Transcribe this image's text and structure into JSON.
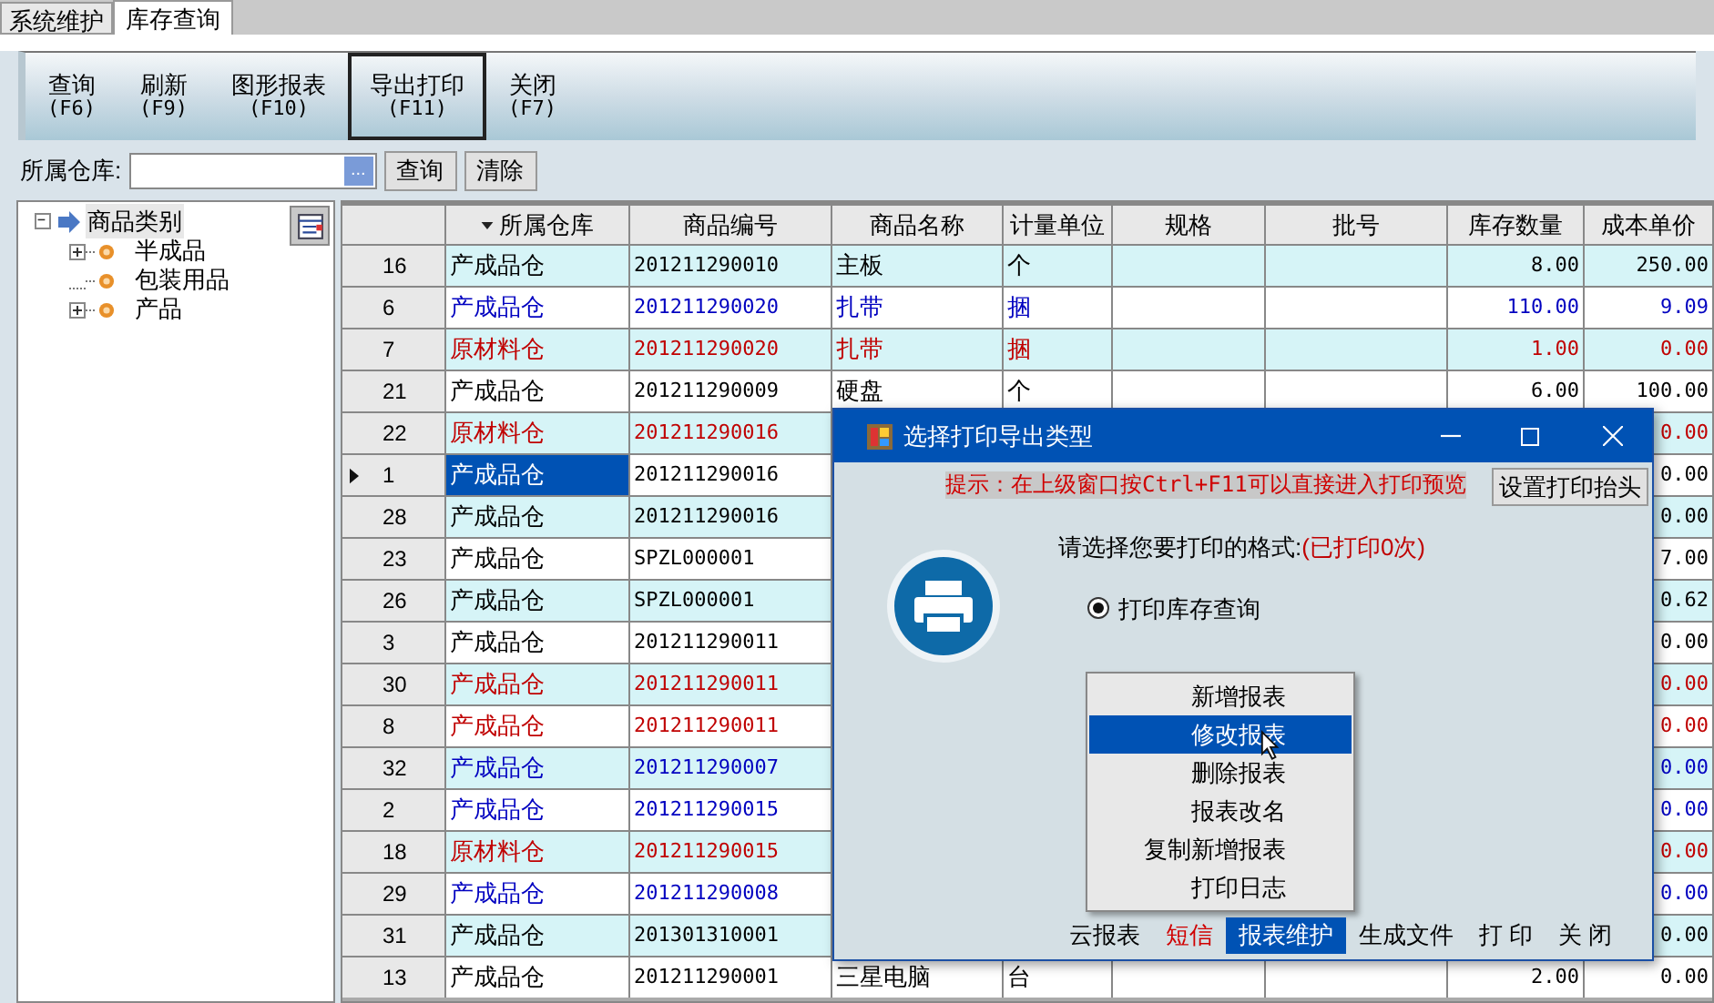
{
  "top_tabs": [
    {
      "label": "系统维护",
      "selected": false
    },
    {
      "label": "库存查询",
      "selected": true
    }
  ],
  "toolbar": [
    {
      "label": "查询",
      "shortcut": "(F6)",
      "selected": false
    },
    {
      "label": "刷新",
      "shortcut": "(F9)",
      "selected": false
    },
    {
      "label": "图形报表",
      "shortcut": "(F10)",
      "selected": false
    },
    {
      "label": "导出打印",
      "shortcut": "(F11)",
      "selected": true
    },
    {
      "label": "关闭",
      "shortcut": "(F7)",
      "selected": false
    }
  ],
  "filter": {
    "label": "所属仓库:",
    "browse": "...",
    "buttons": [
      "查询",
      "清除"
    ]
  },
  "tree": {
    "label": "商品类别",
    "expanded": true,
    "selected": true,
    "children": [
      {
        "label": "半成品",
        "kind": "branch",
        "expanded": false,
        "selected": false
      },
      {
        "label": "包装用品",
        "kind": "leaf",
        "selected": false
      },
      {
        "label": "产品",
        "kind": "branch",
        "expanded": false,
        "selected": false
      }
    ]
  },
  "grid": {
    "columns": [
      "所属仓库",
      "商品编号",
      "商品名称",
      "计量单位",
      "规格",
      "批号",
      "库存数量",
      "成本单价"
    ],
    "rows": [
      {
        "no": "16",
        "warehouse": "产成品仓",
        "code": "201211290010",
        "name": "主板",
        "unit": "个",
        "qty": "8.00",
        "cost": "250.00",
        "color": "#000000",
        "selected": false
      },
      {
        "no": "6",
        "warehouse": "产成品仓",
        "code": "201211290020",
        "name": "扎带",
        "unit": "捆",
        "qty": "110.00",
        "cost": "9.09",
        "color": "#0000c0",
        "selected": false
      },
      {
        "no": "7",
        "warehouse": "原材料仓",
        "code": "201211290020",
        "name": "扎带",
        "unit": "捆",
        "qty": "1.00",
        "cost": "0.00",
        "color": "#c00000",
        "selected": false
      },
      {
        "no": "21",
        "warehouse": "产成品仓",
        "code": "201211290009",
        "name": "硬盘",
        "unit": "个",
        "qty": "6.00",
        "cost": "100.00",
        "color": "#000000",
        "selected": false
      },
      {
        "no": "22",
        "warehouse": "原材料仓",
        "code": "201211290016",
        "cost": "0.00",
        "color": "#c00000",
        "selected": false
      },
      {
        "no": "1",
        "warehouse": "产成品仓",
        "code": "201211290016",
        "cost": "0.00",
        "color": "#000000",
        "selected": true
      },
      {
        "no": "28",
        "warehouse": "产成品仓",
        "code": "201211290016",
        "cost": "0.00",
        "color": "#000000",
        "selected": false
      },
      {
        "no": "23",
        "warehouse": "产成品仓",
        "code": "SPZL000001",
        "cost": "7.00",
        "color": "#000000",
        "selected": false
      },
      {
        "no": "26",
        "warehouse": "产成品仓",
        "code": "SPZL000001",
        "cost": "0.62",
        "color": "#000000",
        "selected": false
      },
      {
        "no": "3",
        "warehouse": "产成品仓",
        "code": "201211290011",
        "cost": "0.00",
        "color": "#000000",
        "selected": false
      },
      {
        "no": "30",
        "warehouse": "产成品仓",
        "code": "201211290011",
        "cost": "0.00",
        "color": "#c00000",
        "selected": false
      },
      {
        "no": "8",
        "warehouse": "产成品仓",
        "code": "201211290011",
        "cost": "0.00",
        "color": "#c00000",
        "selected": false
      },
      {
        "no": "32",
        "warehouse": "产成品仓",
        "code": "201211290007",
        "cost": "0.00",
        "color": "#0000c0",
        "selected": false
      },
      {
        "no": "2",
        "warehouse": "产成品仓",
        "code": "201211290015",
        "cost": "0.00",
        "color": "#0000c0",
        "selected": false
      },
      {
        "no": "18",
        "warehouse": "原材料仓",
        "code": "201211290015",
        "cost": "0.00",
        "color": "#c00000",
        "selected": false
      },
      {
        "no": "29",
        "warehouse": "产成品仓",
        "code": "201211290008",
        "cost": "0.00",
        "color": "#0000c0",
        "selected": false
      },
      {
        "no": "31",
        "warehouse": "产成品仓",
        "code": "201301310001",
        "cost": "0.00",
        "color": "#000000",
        "selected": false
      },
      {
        "no": "13",
        "warehouse": "产成品仓",
        "code": "201211290001",
        "name": "三星电脑",
        "unit": "台",
        "qty": "2.00",
        "cost": "0.00",
        "color": "#000000",
        "selected": false
      }
    ]
  },
  "dialog": {
    "title": "选择打印导出类型",
    "hint": "提示：在上级窗口按Ctrl+F11可以直接进入打印预览",
    "header_button": "设置打印抬头",
    "prompt": "请选择您要打印的格式:",
    "print_count": "(已打印0次)",
    "options": [
      {
        "label": "打印库存查询",
        "selected": true
      }
    ],
    "menu": [
      {
        "label": "新增报表",
        "selected": false
      },
      {
        "label": "修改报表",
        "selected": true
      },
      {
        "label": "删除报表",
        "selected": false
      },
      {
        "label": "报表改名",
        "selected": false
      },
      {
        "label": "复制新增报表",
        "selected": false
      },
      {
        "label": "打印日志",
        "selected": false
      }
    ],
    "buttons": [
      {
        "label": "云报表",
        "alert": false,
        "selected": false
      },
      {
        "label": "短信",
        "alert": true,
        "selected": false
      },
      {
        "label": "报表维护",
        "alert": false,
        "selected": true
      },
      {
        "label": "生成文件",
        "alert": false,
        "selected": false
      },
      {
        "label": "打 印",
        "alert": false,
        "selected": false
      },
      {
        "label": "关 闭",
        "alert": false,
        "selected": false
      }
    ]
  }
}
